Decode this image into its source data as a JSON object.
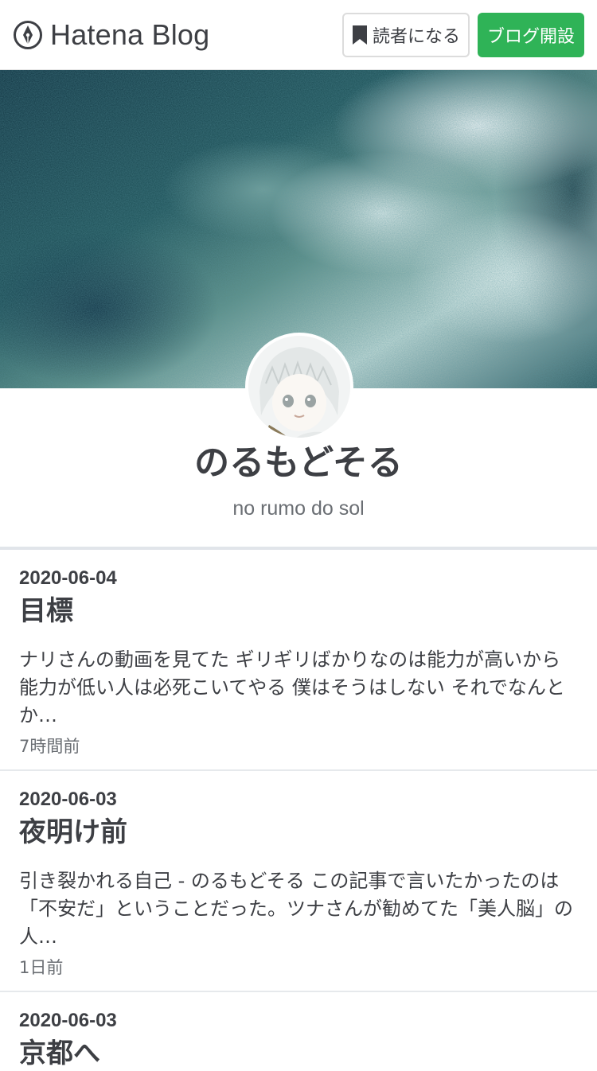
{
  "topbar": {
    "logo_text": "Hatena Blog",
    "subscribe_label": "読者になる",
    "open_blog_label": "ブログ開設"
  },
  "blog": {
    "title": "のるもどそる",
    "subtitle": "no rumo do sol"
  },
  "entries": [
    {
      "date": "2020-06-04",
      "title": "目標",
      "summary": "ナリさんの動画を見てた ギリギリばかりなのは能力が高いから 能力が低い人は必死こいてやる 僕はそうはしない それでなんとか…",
      "time": "7時間前"
    },
    {
      "date": "2020-06-03",
      "title": "夜明け前",
      "summary": "引き裂かれる自己 - のるもどそる この記事で言いたかったのは「不安だ」ということだった。ツナさんが勧めてた「美人脳」の人…",
      "time": "1日前"
    },
    {
      "date": "2020-06-03",
      "title": "京都へ"
    }
  ],
  "colors": {
    "accent_green": "#2fb357",
    "text_main": "#3d3f44",
    "text_muted": "#6a6e73"
  }
}
